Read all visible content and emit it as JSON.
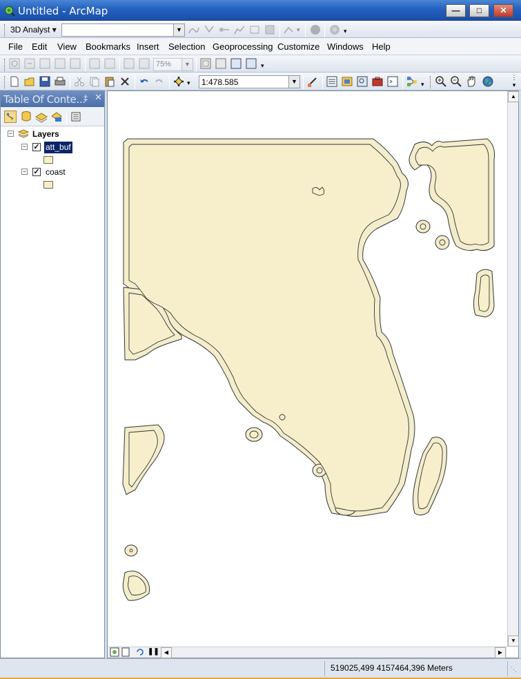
{
  "window": {
    "title": "Untitled - ArcMap"
  },
  "analyst_toolbar": {
    "label": "3D Analyst",
    "layer_combo": ""
  },
  "menu": [
    "File",
    "Edit",
    "View",
    "Bookmarks",
    "Insert",
    "Selection",
    "Geoprocessing",
    "Customize",
    "Windows",
    "Help"
  ],
  "layout_toolbar": {
    "zoom_percent": "75%"
  },
  "standard_toolbar": {
    "scale": "1:478.585"
  },
  "toc": {
    "title": "Table Of Conte...",
    "pin_glyph": "‡",
    "root_label": "Layers",
    "layers": [
      {
        "name": "att_buf",
        "checked": true,
        "selected": true,
        "fill": "#f7efcc",
        "outline": "#6b6b4a"
      },
      {
        "name": "coast",
        "checked": true,
        "selected": false,
        "fill": "#f7efcc",
        "outline": "#6b6b4a"
      }
    ]
  },
  "status": {
    "coordinates": "519025,499  4157464,396 Meters"
  },
  "colors": {
    "polygon_fill": "#f7efcc",
    "buffer_fill": "#f3edcc",
    "outline": "#333333",
    "titlebar": "#2461c0"
  }
}
